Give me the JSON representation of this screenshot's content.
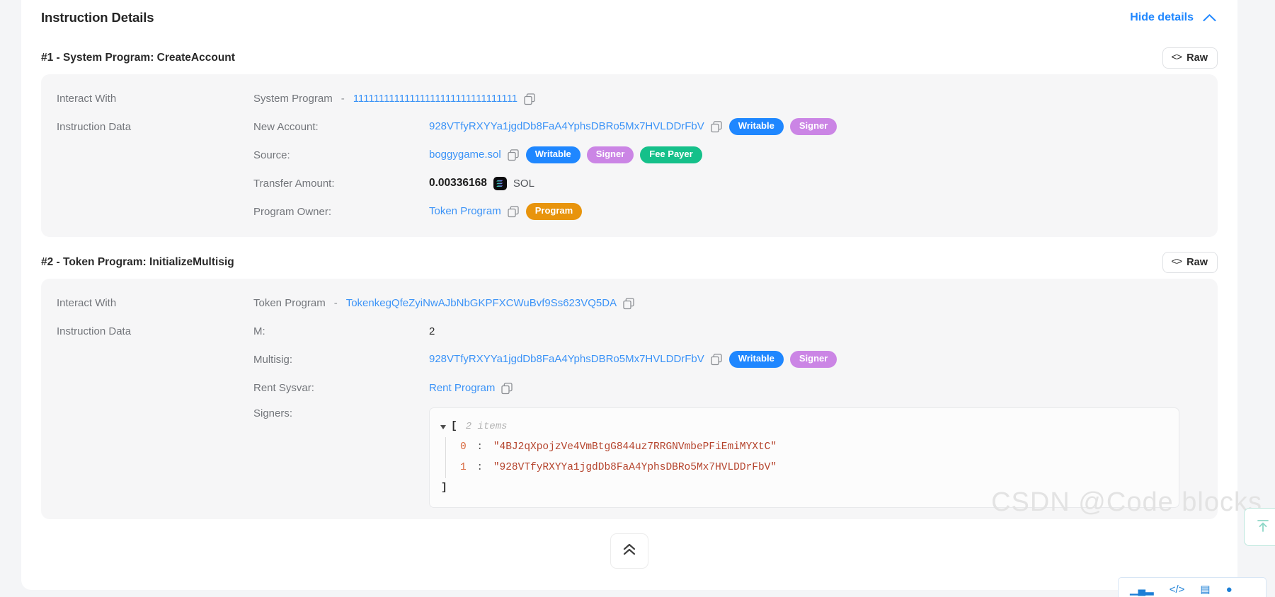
{
  "header": {
    "title": "Instruction Details",
    "hide_details_label": "Hide details",
    "chevron_icon": "chevron-up-icon"
  },
  "raw_button_label": "Raw",
  "raw_button_glyph": "<>",
  "panel_labels": {
    "interact_with": "Interact With",
    "instruction_data": "Instruction Data"
  },
  "badges": {
    "writable": "Writable",
    "signer": "Signer",
    "fee_payer": "Fee Payer",
    "program": "Program"
  },
  "colors": {
    "link": "#3b93f7",
    "writable": "#1f87ff",
    "signer": "#cb85e5",
    "fee_payer": "#15c08a",
    "program": "#e8940c",
    "accent": "#1f87ff",
    "json_key": "#d9693f",
    "json_string": "#b5442d"
  },
  "instructions": [
    {
      "title": "#1 - System Program: CreateAccount",
      "interact_with": {
        "program_name": "System Program",
        "separator": "-",
        "address": "11111111111111111111111111111111"
      },
      "rows": [
        {
          "key": "New Account:",
          "value": "928VTfyRXYYa1jgdDb8FaA4YphsDBRo5Mx7HVLDDrFbV",
          "badges": [
            "Writable",
            "Signer"
          ]
        },
        {
          "key": "Source:",
          "value": "boggygame.sol",
          "badges": [
            "Writable",
            "Signer",
            "Fee Payer"
          ]
        },
        {
          "key": "Transfer Amount:",
          "amount": "0.00336168",
          "unit": "SOL"
        },
        {
          "key": "Program Owner:",
          "value": "Token Program",
          "badges": [
            "Program"
          ]
        }
      ]
    },
    {
      "title": "#2 - Token Program: InitializeMultisig",
      "interact_with": {
        "program_name": "Token Program",
        "separator": "-",
        "address": "TokenkegQfeZyiNwAJbNbGKPFXCWuBvf9Ss623VQ5DA"
      },
      "rows": [
        {
          "key": "M:",
          "plain": "2"
        },
        {
          "key": "Multisig:",
          "value": "928VTfyRXYYa1jgdDb8FaA4YphsDBRo5Mx7HVLDDrFbV",
          "badges": [
            "Writable",
            "Signer"
          ]
        },
        {
          "key": "Rent Sysvar:",
          "value": "Rent Program"
        },
        {
          "key": "Signers:",
          "json": {
            "open_bracket": "[",
            "close_bracket": "]",
            "items_note": "2 items",
            "entries": [
              {
                "index": "0",
                "colon": ":",
                "value": "\"4BJ2qXpojzVe4VmBtgG844uz7RRGNVmbePFiEmiMYXtC\""
              },
              {
                "index": "1",
                "colon": ":",
                "value": "\"928VTfyRXYYa1jgdDb8FaA4YphsDBRo5Mx7HVLDDrFbV\""
              }
            ]
          }
        }
      ]
    }
  ],
  "collapse_button_icon": "double-chevron-up-icon",
  "watermark": "CSDN @Code blocks",
  "scroll_top_icon": "arrow-up-to-line-icon"
}
